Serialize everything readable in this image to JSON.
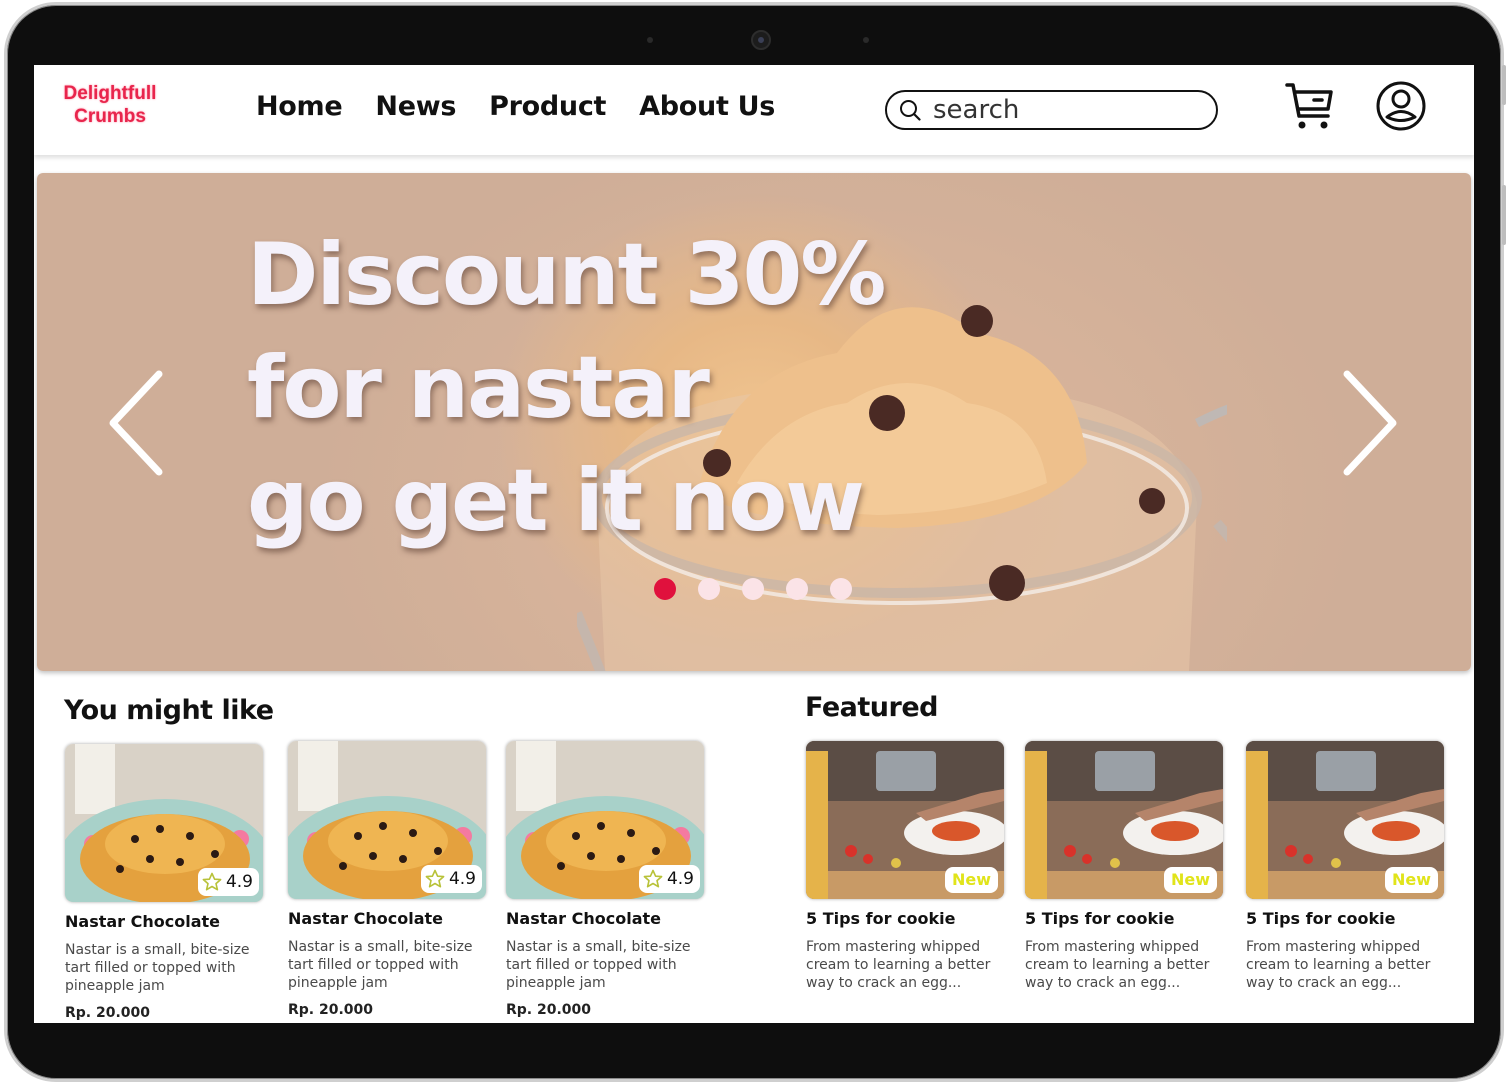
{
  "brand": {
    "line1": "Delightfull",
    "line2": "Crumbs"
  },
  "nav": [
    "Home",
    "News",
    "Product",
    "About Us"
  ],
  "search": {
    "placeholder": "search",
    "value": ""
  },
  "hero": {
    "lines": [
      "Discount 30%",
      "for nastar",
      "go get it now"
    ],
    "slide_count": 5,
    "active_slide": 1
  },
  "sections": {
    "recommend_title": "You might like",
    "featured_title": "Featured"
  },
  "products": [
    {
      "name": "Nastar Chocolate",
      "desc": "Nastar is a small, bite-size tart filled or topped with pineapple jam",
      "price": "Rp. 20.000",
      "rating": "4.9"
    },
    {
      "name": "Nastar Chocolate",
      "desc": "Nastar is a small, bite-size tart filled or topped with pineapple jam",
      "price": "Rp. 20.000",
      "rating": "4.9"
    },
    {
      "name": "Nastar Chocolate",
      "desc": "Nastar is a small, bite-size tart filled or topped with pineapple jam",
      "price": "Rp. 20.000",
      "rating": "4.9"
    }
  ],
  "featured": [
    {
      "title": "5 Tips for cookie",
      "desc": "From mastering whipped cream to learning a better way to crack an egg...",
      "badge": "New"
    },
    {
      "title": "5 Tips for cookie",
      "desc": "From mastering whipped cream to learning a better way to crack an egg...",
      "badge": "New"
    },
    {
      "title": "5 Tips for cookie",
      "desc": "From mastering whipped cream to learning a better way to crack an egg...",
      "badge": "New"
    }
  ],
  "colors": {
    "brand": "#e8254c",
    "dot_active": "#e0113d",
    "dot_inactive": "#fbe3e7",
    "badge_new": "#e1e41a"
  },
  "icons": [
    "search-icon",
    "cart-icon",
    "user-icon",
    "chevron-left-icon",
    "chevron-right-icon",
    "star-icon"
  ]
}
